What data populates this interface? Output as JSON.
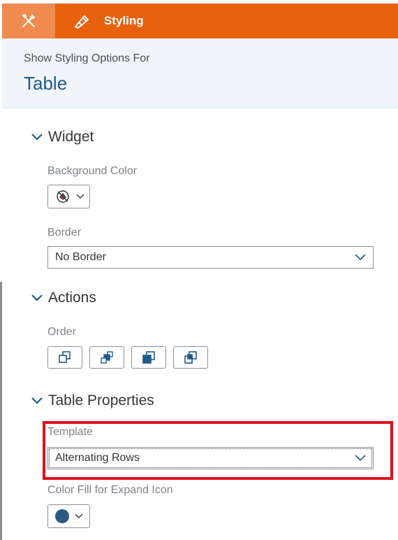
{
  "toolbar": {
    "tools_icon": "tools-icon",
    "styling_icon": "paint-brush-icon",
    "styling_label": "Styling"
  },
  "header": {
    "subtitle": "Show Styling Options For",
    "title": "Table"
  },
  "sections": {
    "widget": {
      "title": "Widget",
      "background_color_label": "Background Color",
      "border_label": "Border",
      "border_value": "No Border"
    },
    "actions": {
      "title": "Actions",
      "order_label": "Order",
      "order_buttons": [
        "bring-to-front-icon",
        "bring-forward-icon",
        "send-backward-icon",
        "send-to-back-icon"
      ]
    },
    "table_properties": {
      "title": "Table Properties",
      "template_label": "Template",
      "template_value": "Alternating Rows",
      "expand_icon_fill_label": "Color Fill for Expand Icon",
      "expand_icon_fill_color": "#2b5a85"
    }
  },
  "colors": {
    "accent": "#e8620e",
    "accent_light": "#f08a4e",
    "title_blue": "#1f5a8a",
    "highlight_red": "#e0101e"
  }
}
